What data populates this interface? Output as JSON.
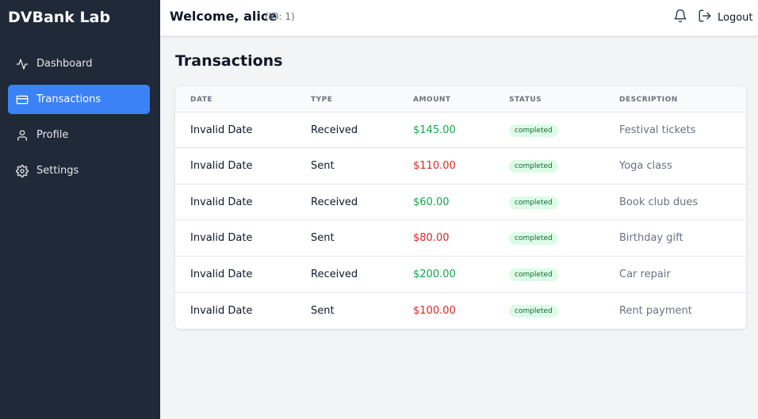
{
  "sidebar": {
    "brand": "DVBank Lab",
    "items": [
      {
        "label": "Dashboard",
        "icon": "activity-icon"
      },
      {
        "label": "Transactions",
        "icon": "credit-card-icon"
      },
      {
        "label": "Profile",
        "icon": "user-icon"
      },
      {
        "label": "Settings",
        "icon": "gear-icon"
      }
    ],
    "active_index": 1
  },
  "header": {
    "welcome": "Welcome, alice",
    "user_id": "(ID: 1)",
    "logout_label": "Logout"
  },
  "main": {
    "title": "Transactions",
    "columns": [
      "DATE",
      "TYPE",
      "AMOUNT",
      "STATUS",
      "DESCRIPTION"
    ],
    "rows": [
      {
        "date": "Invalid Date",
        "type": "Received",
        "amount": "$145.00",
        "status": "completed",
        "description": "Festival tickets",
        "direction": "in"
      },
      {
        "date": "Invalid Date",
        "type": "Sent",
        "amount": "$110.00",
        "status": "completed",
        "description": "Yoga class",
        "direction": "out"
      },
      {
        "date": "Invalid Date",
        "type": "Received",
        "amount": "$60.00",
        "status": "completed",
        "description": "Book club dues",
        "direction": "in"
      },
      {
        "date": "Invalid Date",
        "type": "Sent",
        "amount": "$80.00",
        "status": "completed",
        "description": "Birthday gift",
        "direction": "out"
      },
      {
        "date": "Invalid Date",
        "type": "Received",
        "amount": "$200.00",
        "status": "completed",
        "description": "Car repair",
        "direction": "in"
      },
      {
        "date": "Invalid Date",
        "type": "Sent",
        "amount": "$100.00",
        "status": "completed",
        "description": "Rent payment",
        "direction": "out"
      }
    ]
  },
  "colors": {
    "sidebar_bg": "#1f2937",
    "accent": "#3b82f6",
    "positive": "#16a34a",
    "negative": "#dc2626",
    "badge_bg": "#dcfce7"
  }
}
